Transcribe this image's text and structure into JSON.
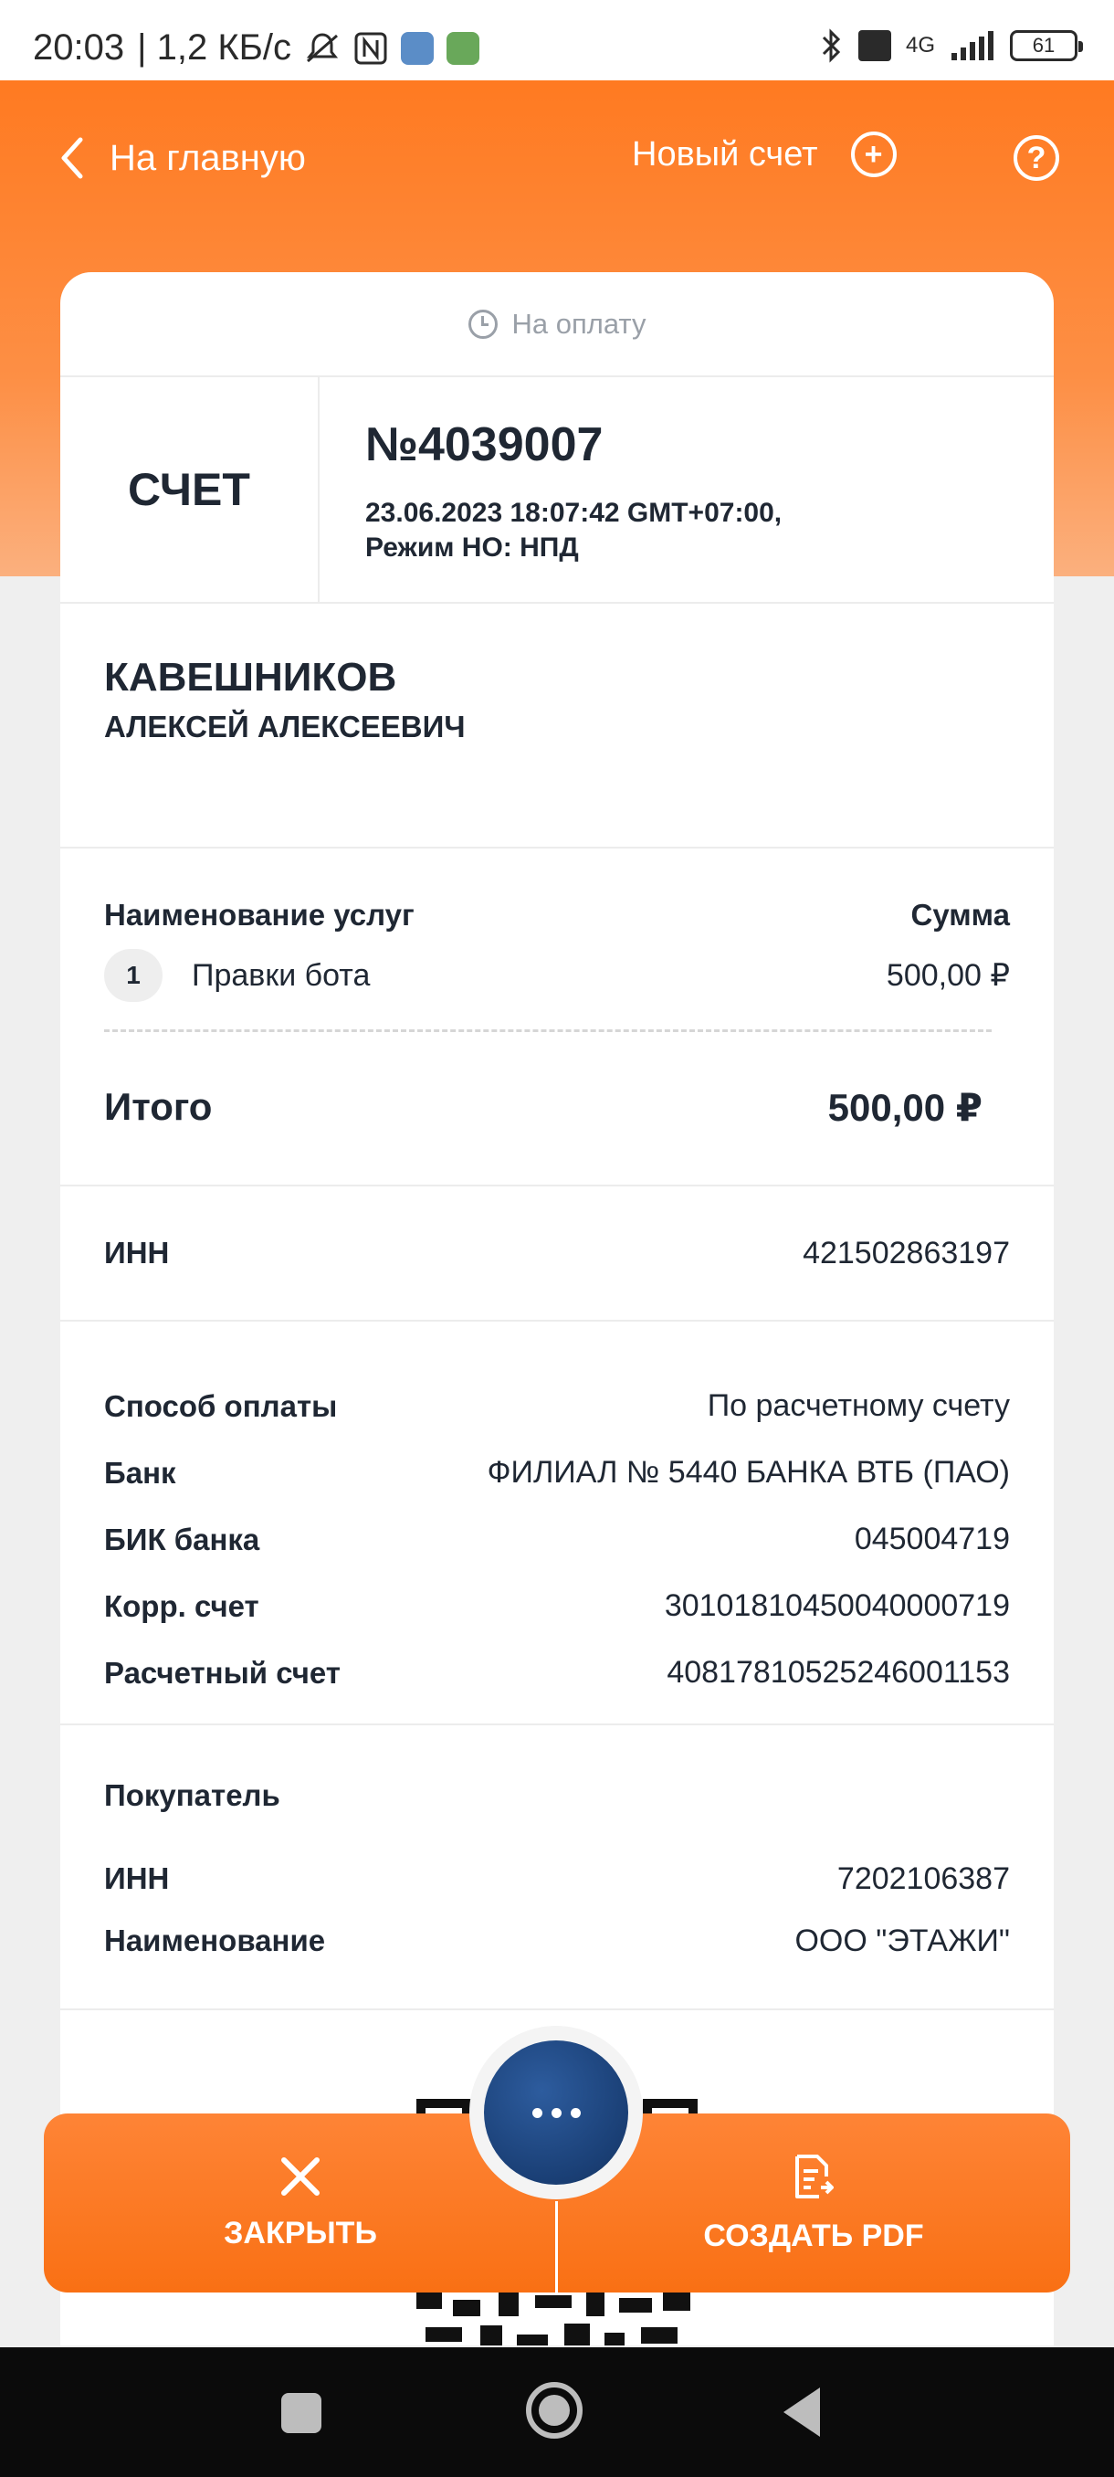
{
  "status_bar": {
    "time": "20:03",
    "net_speed": "| 1,2 КБ/с",
    "network_label": "4G",
    "battery": "61"
  },
  "header": {
    "back_label": "На главную",
    "new_invoice_label": "Новый счет"
  },
  "invoice": {
    "status": "На оплату",
    "doc_type": "СЧЕТ",
    "number": "№4039007",
    "datetime": "23.06.2023 18:07:42 GMT+07:00,",
    "tax_mode": "Режим НО: НПД",
    "seller_last_name": "КАВЕШНИКОВ",
    "seller_first_names": "АЛЕКСЕЙ АЛЕКСЕЕВИЧ"
  },
  "services": {
    "col_name": "Наименование услуг",
    "col_sum": "Сумма",
    "items": [
      {
        "index": "1",
        "name": "Правки бота",
        "amount": "500,00 ₽"
      }
    ],
    "total_label": "Итого",
    "total_value": "500,00 ₽"
  },
  "inn": {
    "label": "ИНН",
    "value": "421502863197"
  },
  "payment": {
    "rows": [
      {
        "label": "Способ оплаты",
        "value": "По расчетному счету"
      },
      {
        "label": "Банк",
        "value": "ФИЛИАЛ № 5440 БАНКА ВТБ (ПАО)"
      },
      {
        "label": "БИК банка",
        "value": "045004719"
      },
      {
        "label": "Корр. счет",
        "value": "30101810450040000719"
      },
      {
        "label": "Расчетный счет",
        "value": "40817810525246001153"
      }
    ]
  },
  "buyer": {
    "title": "Покупатель",
    "rows": [
      {
        "label": "ИНН",
        "value": "7202106387"
      },
      {
        "label": "Наименование",
        "value": "ООО \"ЭТАЖИ\""
      }
    ]
  },
  "actions": {
    "close_label": "ЗАКРЫТЬ",
    "pdf_label": "СОЗДАТЬ PDF"
  },
  "icons": {
    "back": "chevron-left-icon",
    "add": "plus-circle-icon",
    "help": "question-circle-icon",
    "status": "clock-icon",
    "close": "close-icon",
    "pdf": "document-export-icon",
    "more": "more-dots-icon"
  },
  "colors": {
    "accent": "#fe7a1f",
    "fab": "#1f4a86",
    "text": "#1f2733"
  }
}
